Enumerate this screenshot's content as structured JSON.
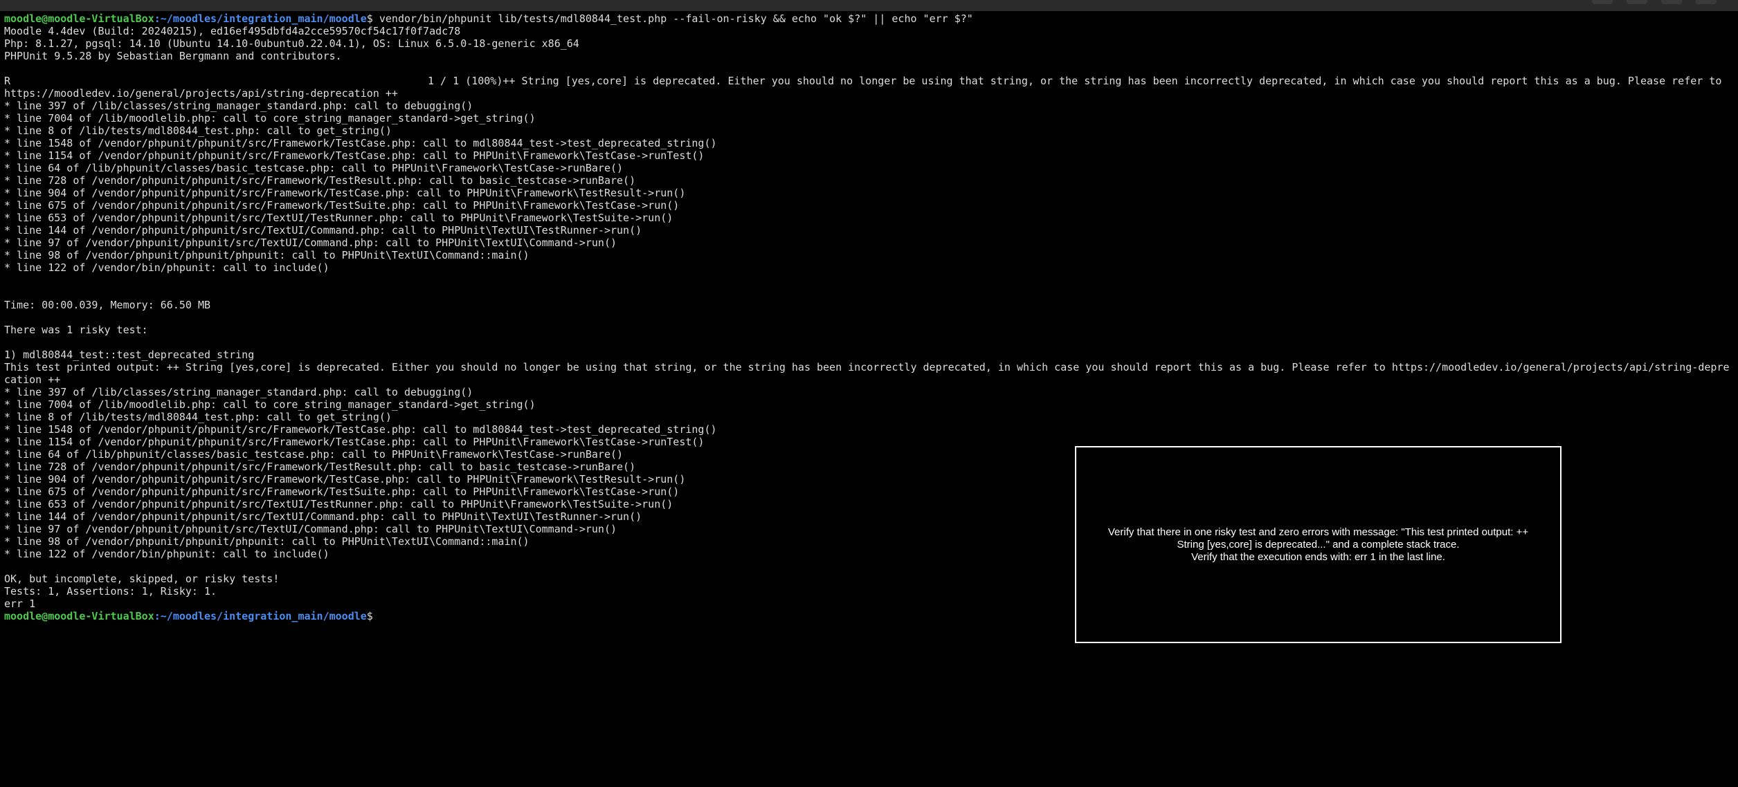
{
  "prompt": {
    "user_host": "moodle@moodle-VirtualBox",
    "path": ":~/moodles/integration_main/moodle",
    "symbol": "$ "
  },
  "command": "vendor/bin/phpunit lib/tests/mdl80844_test.php --fail-on-risky && echo \"ok $?\" || echo \"err $?\"",
  "header": {
    "moodle": "Moodle 4.4dev (Build: 20240215), ed16ef495dbfd4a2cce59570cf54c17f0f7adc78",
    "php": "Php: 8.1.27, pgsql: 14.10 (Ubuntu 14.10-0ubuntu0.22.04.1), OS: Linux 6.5.0-18-generic x86_64",
    "phpunit": "PHPUnit 9.5.28 by Sebastian Bergmann and contributors."
  },
  "progress": {
    "marker": "R",
    "count": "1 / 1 (100%)",
    "message": "++ String [yes,core] is deprecated. Either you should no longer be using that string, or the string has been incorrectly deprecated, in which case you should report this as a bug. Please refer to",
    "message_cont": "https://moodledev.io/general/projects/api/string-deprecation ++"
  },
  "trace1": [
    "* line 397 of /lib/classes/string_manager_standard.php: call to debugging()",
    "* line 7004 of /lib/moodlelib.php: call to core_string_manager_standard->get_string()",
    "* line 8 of /lib/tests/mdl80844_test.php: call to get_string()",
    "* line 1548 of /vendor/phpunit/phpunit/src/Framework/TestCase.php: call to mdl80844_test->test_deprecated_string()",
    "* line 1154 of /vendor/phpunit/phpunit/src/Framework/TestCase.php: call to PHPUnit\\Framework\\TestCase->runTest()",
    "* line 64 of /lib/phpunit/classes/basic_testcase.php: call to PHPUnit\\Framework\\TestCase->runBare()",
    "* line 728 of /vendor/phpunit/phpunit/src/Framework/TestResult.php: call to basic_testcase->runBare()",
    "* line 904 of /vendor/phpunit/phpunit/src/Framework/TestCase.php: call to PHPUnit\\Framework\\TestResult->run()",
    "* line 675 of /vendor/phpunit/phpunit/src/Framework/TestSuite.php: call to PHPUnit\\Framework\\TestCase->run()",
    "* line 653 of /vendor/phpunit/phpunit/src/TextUI/TestRunner.php: call to PHPUnit\\Framework\\TestSuite->run()",
    "* line 144 of /vendor/phpunit/phpunit/src/TextUI/Command.php: call to PHPUnit\\TextUI\\TestRunner->run()",
    "* line 97 of /vendor/phpunit/phpunit/src/TextUI/Command.php: call to PHPUnit\\TextUI\\Command->run()",
    "* line 98 of /vendor/phpunit/phpunit/phpunit: call to PHPUnit\\TextUI\\Command::main()",
    "* line 122 of /vendor/bin/phpunit: call to include()"
  ],
  "time_memory": "Time: 00:00.039, Memory: 66.50 MB",
  "risky_header": "There was 1 risky test:",
  "risky_test_name": "1) mdl80844_test::test_deprecated_string",
  "risky_output": "This test printed output: ++ String [yes,core] is deprecated. Either you should no longer be using that string, or the string has been incorrectly deprecated, in which case you should report this as a bug. Please refer to https://moodledev.io/general/projects/api/string-depre",
  "risky_output_cont": "cation ++",
  "trace2": [
    "* line 397 of /lib/classes/string_manager_standard.php: call to debugging()",
    "* line 7004 of /lib/moodlelib.php: call to core_string_manager_standard->get_string()",
    "* line 8 of /lib/tests/mdl80844_test.php: call to get_string()",
    "* line 1548 of /vendor/phpunit/phpunit/src/Framework/TestCase.php: call to mdl80844_test->test_deprecated_string()",
    "* line 1154 of /vendor/phpunit/phpunit/src/Framework/TestCase.php: call to PHPUnit\\Framework\\TestCase->runTest()",
    "* line 64 of /lib/phpunit/classes/basic_testcase.php: call to PHPUnit\\Framework\\TestCase->runBare()",
    "* line 728 of /vendor/phpunit/phpunit/src/Framework/TestResult.php: call to basic_testcase->runBare()",
    "* line 904 of /vendor/phpunit/phpunit/src/Framework/TestCase.php: call to PHPUnit\\Framework\\TestResult->run()",
    "* line 675 of /vendor/phpunit/phpunit/src/Framework/TestSuite.php: call to PHPUnit\\Framework\\TestCase->run()",
    "* line 653 of /vendor/phpunit/phpunit/src/TextUI/TestRunner.php: call to PHPUnit\\Framework\\TestSuite->run()",
    "* line 144 of /vendor/phpunit/phpunit/src/TextUI/Command.php: call to PHPUnit\\TextUI\\TestRunner->run()",
    "* line 97 of /vendor/phpunit/phpunit/src/TextUI/Command.php: call to PHPUnit\\TextUI\\Command->run()",
    "* line 98 of /vendor/phpunit/phpunit/phpunit: call to PHPUnit\\TextUI\\Command::main()",
    "* line 122 of /vendor/bin/phpunit: call to include()"
  ],
  "summary": {
    "status": "OK, but incomplete, skipped, or risky tests!",
    "counts": "Tests: 1, Assertions: 1, Risky: 1.",
    "exit": "err 1"
  },
  "overlay": {
    "line1": "Verify that there in one risky test and zero errors with message: \"This test printed output: ++",
    "line2": "String [yes,core] is deprecated...\" and a complete stack trace.",
    "line3": "Verify that the execution ends with: err 1 in the last line."
  },
  "colors": {
    "background": "#000000",
    "prompt_user": "#4ec94e",
    "prompt_path": "#4b8df0",
    "text": "#dcdcdc"
  }
}
